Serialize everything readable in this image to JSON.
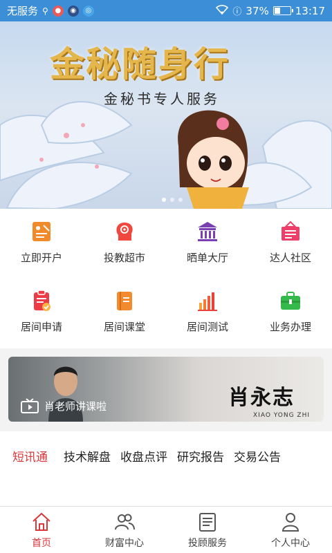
{
  "status_bar": {
    "carrier": "无服务",
    "battery": "37%",
    "battery_level": 0.37,
    "time": "13:17"
  },
  "banner": {
    "title": "金秘随身行",
    "subtitle": "金秘书专人服务",
    "page_count": 3,
    "active_page": 0
  },
  "grid": [
    {
      "label": "立即开户",
      "icon": "open-account-icon",
      "color": "#f08a2a"
    },
    {
      "label": "投教超市",
      "icon": "investor-education-icon",
      "color": "#f0473f"
    },
    {
      "label": "晒单大厅",
      "icon": "hall-icon",
      "color": "#7b3fb4"
    },
    {
      "label": "达人社区",
      "icon": "community-icon",
      "color": "#ee3f6a"
    },
    {
      "label": "居间申请",
      "icon": "application-icon",
      "color": "#ee3a45"
    },
    {
      "label": "居间课堂",
      "icon": "classroom-icon",
      "color": "#f28a2e"
    },
    {
      "label": "居间测试",
      "icon": "chart-test-icon",
      "color": "#f05d3a"
    },
    {
      "label": "业务办理",
      "icon": "briefcase-icon",
      "color": "#35b94a"
    }
  ],
  "video": {
    "caption": "肖老师讲课啦",
    "name": "肖永志",
    "pinyin": "XIAO YONG ZHI"
  },
  "tabs": [
    {
      "label": "短讯通",
      "active": true
    },
    {
      "label": "技术解盘",
      "active": false
    },
    {
      "label": "收盘点评",
      "active": false
    },
    {
      "label": "研究报告",
      "active": false
    },
    {
      "label": "交易公告",
      "active": false
    }
  ],
  "bottom_nav": [
    {
      "label": "首页",
      "icon": "home-icon",
      "active": true
    },
    {
      "label": "财富中心",
      "icon": "users-icon",
      "active": false
    },
    {
      "label": "投顾服务",
      "icon": "document-icon",
      "active": false
    },
    {
      "label": "个人中心",
      "icon": "person-icon",
      "active": false
    }
  ],
  "colors": {
    "accent": "#d9373a",
    "status_bar": "#3c8fd6"
  }
}
